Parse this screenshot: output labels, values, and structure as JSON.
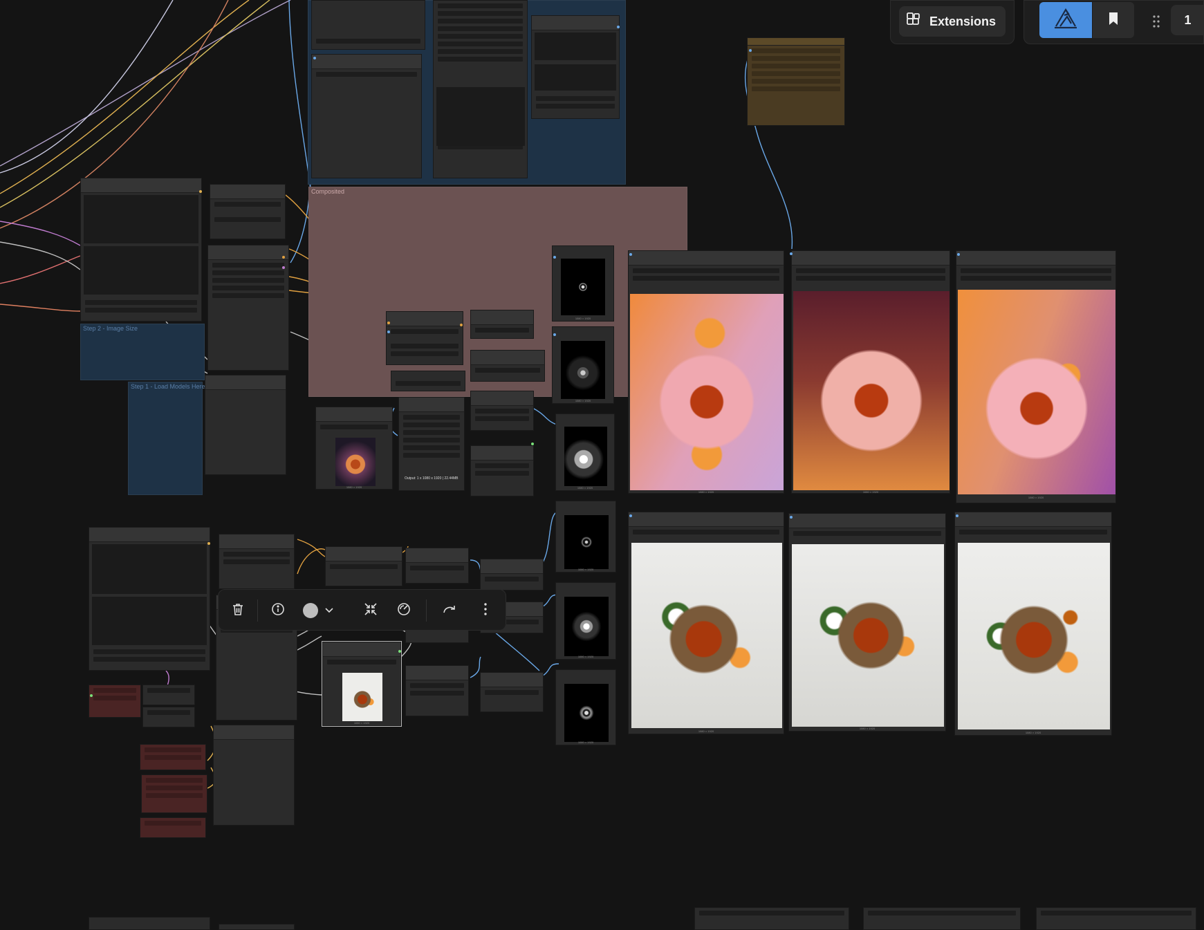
{
  "topbar": {
    "extensions_label": "Extensions",
    "queue_count": "1"
  },
  "groups": {
    "step2_title": "Step 2 - Image Size",
    "step1_title": "Step 1 - Load Models Here",
    "pink_title": "Composited"
  },
  "overlays": {
    "output_info": "Output: 1 x 1080 x 1920 | 22.44MB"
  },
  "previews": [
    {
      "caption": "1080 × 1920",
      "style": "orange-lavender"
    },
    {
      "caption": "1080 × 1920",
      "style": "burgundy-orange"
    },
    {
      "caption": "1080 × 1920",
      "style": "orange-purple"
    },
    {
      "caption": "1080 × 1920",
      "style": "white-driftwood"
    },
    {
      "caption": "1080 × 1920",
      "style": "white-driftwood"
    },
    {
      "caption": "1080 × 1920",
      "style": "white-driftwood"
    }
  ],
  "mask_captions": [
    "1080 × 1920",
    "1080 × 1920",
    "1080 × 1920",
    "1080 × 1920",
    "1080 × 1920",
    "1080 × 1920"
  ],
  "small_captions": [
    "1080 × 1920",
    "1080 × 1920"
  ],
  "icons": {
    "extensions": "puzzle-blocks-icon",
    "logo": "app-logo-icon",
    "bookmark": "bookmark-icon",
    "drag": "drag-handle-icon",
    "delete": "trash-icon",
    "info": "info-icon",
    "color": "color-circle-icon",
    "chevron": "chevron-down-icon",
    "collapse": "collapse-icon",
    "bypass": "bypass-icon",
    "redo": "redo-icon",
    "more": "more-vertical-icon"
  },
  "colors": {
    "canvas": "#141414",
    "accent": "#4a8fe0",
    "node": "#2b2b2b",
    "group_blue": "#1e3246",
    "group_pink": "#6b5252"
  }
}
